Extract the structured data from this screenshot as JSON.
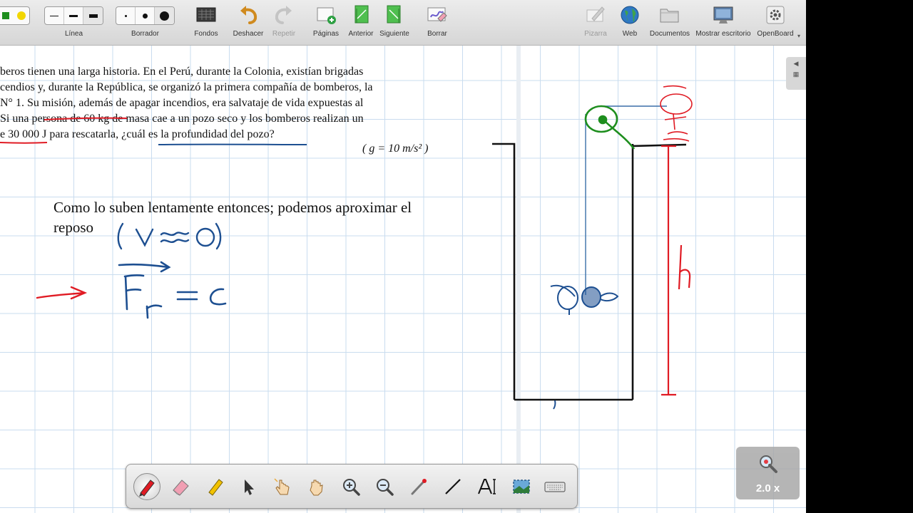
{
  "toolbar": {
    "line_label": "Línea",
    "eraser_label": "Borrador",
    "backgrounds_label": "Fondos",
    "undo_label": "Deshacer",
    "redo_label": "Repetir",
    "pages_label": "Páginas",
    "previous_label": "Anterior",
    "next_label": "Siguiente",
    "clear_label": "Borrar",
    "board_label": "Pizarra",
    "web_label": "Web",
    "documents_label": "Documentos",
    "desktop_label": "Mostrar escritorio",
    "openboard_label": "OpenBoard"
  },
  "problem": {
    "line1": "beros tienen una larga historia. En el Perú, durante la Colonia, existían brigadas",
    "line2": "cendios y, durante la República, se organizó la primera compañía de bomberos, la",
    "line3": "N° 1. Su misión, además de apagar incendios, era salvataje de vida expuestas al",
    "line4": "Si una persona de 60 kg de masa cae a un pozo seco y los bomberos realizan un",
    "line5": "e 30 000 J para rescatarla, ¿cuál es la profundidad del pozo?",
    "gravity": "( g = 10 m/s² )"
  },
  "notes": {
    "line1": "Como lo suben lentamente entonces; podemos aproximar el",
    "line2": "reposo"
  },
  "zoom": {
    "level": "2.0 x"
  },
  "colors": {
    "ink_red": "#e01b24",
    "ink_blue": "#1d4f91",
    "ink_green": "#1e8e1e",
    "ink_black": "#111111",
    "rope_blue": "#3a6fa8",
    "grid": "#c9dcef"
  },
  "palette": {
    "tools": [
      "pen-icon",
      "eraser-icon",
      "highlighter-icon",
      "pointer-icon",
      "interact-hand-icon",
      "move-hand-icon",
      "zoom-in-icon",
      "zoom-out-icon",
      "laser-pointer-icon",
      "line-icon",
      "text-icon",
      "capture-icon",
      "keyboard-icon"
    ]
  }
}
